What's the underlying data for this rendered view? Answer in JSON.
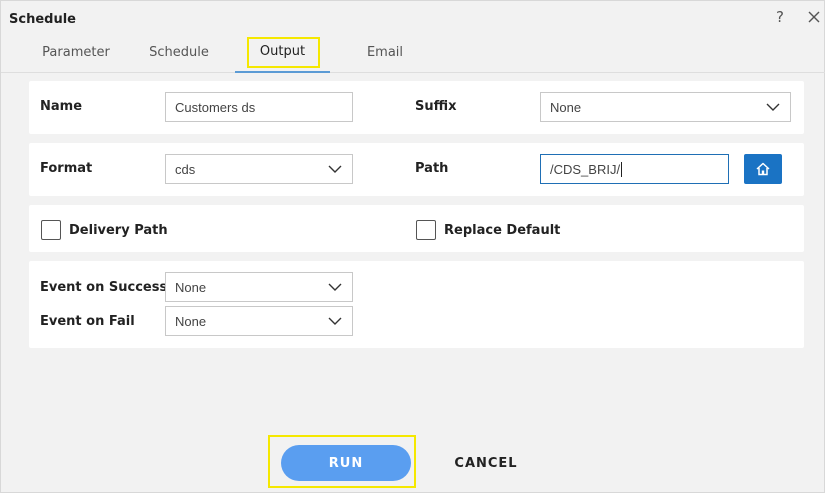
{
  "dialog": {
    "title": "Schedule",
    "help_glyph": "?",
    "tabs": [
      {
        "label": "Parameter"
      },
      {
        "label": "Schedule"
      },
      {
        "label": "Output"
      },
      {
        "label": "Email"
      }
    ],
    "active_tab": "Output"
  },
  "output": {
    "name_label": "Name",
    "name_value": "Customers ds",
    "suffix_label": "Suffix",
    "suffix_value": "None",
    "format_label": "Format",
    "format_value": "cds",
    "path_label": "Path",
    "path_value": "/CDS_BRIJ/",
    "delivery_path_label": "Delivery Path",
    "delivery_path_checked": false,
    "replace_default_label": "Replace Default",
    "replace_default_checked": false,
    "event_success_label": "Event on Success",
    "event_success_value": "None",
    "event_fail_label": "Event on Fail",
    "event_fail_value": "None"
  },
  "actions": {
    "run_label": "RUN",
    "cancel_label": "CANCEL"
  },
  "colors": {
    "accent": "#1a73c4",
    "run_button": "#5a9ef0",
    "highlight": "#f5e800",
    "tab_underline": "#5b9bd5"
  },
  "icons": {
    "help": "question-mark-icon",
    "close": "close-icon",
    "home": "home-icon",
    "dropdown": "chevron-down-icon"
  }
}
